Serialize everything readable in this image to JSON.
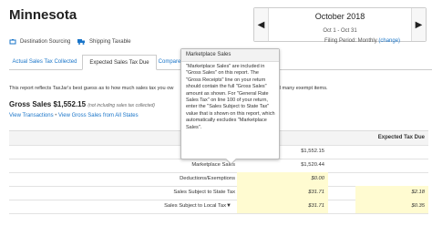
{
  "state_name": "Minnesota",
  "period": {
    "title": "October 2018",
    "range": "Oct 1 - Oct 31",
    "prev_icon": "chevron-left-icon",
    "next_icon": "chevron-right-icon"
  },
  "meta": {
    "sourcing": "Destination Sourcing",
    "taxable": "Shipping Taxable",
    "filing_label": "Filing Period: Monthly",
    "filing_change": "(change)"
  },
  "tabs": [
    {
      "label": "Actual Sales Tax Collected"
    },
    {
      "label": "Expected Sales Tax Due"
    },
    {
      "label": "Compare"
    }
  ],
  "description": "This report reflects TaxJar's best guess as to how much sales tax you ow",
  "description_tail": "ell many exempt items.",
  "gross_sales": {
    "label": "Gross Sales",
    "value": "$1,552.15",
    "note": "(not including sales tax collected)"
  },
  "links": {
    "view_transactions": "View Transactions",
    "separator": "•",
    "view_gross": "View Gross Sales from All States"
  },
  "table": {
    "expected_header": "Expected Tax Due",
    "rows": [
      {
        "label": "",
        "amount": "$1,552.15",
        "due": ""
      },
      {
        "label": "Marketplace Sales",
        "amount": "$1,520.44",
        "due": ""
      },
      {
        "label": "Deductions/Exemptions",
        "amount": "$0.00",
        "due": ""
      },
      {
        "label": "Sales Subject to State Tax",
        "amount": "$31.71",
        "due": "$2.18"
      },
      {
        "label": "Sales Subject to Local Tax",
        "amount": "$31.71",
        "due": "$0.35"
      }
    ]
  },
  "tooltip": {
    "title": "Marketplace Sales",
    "body": "\"Marketplace Sales\" are included in \"Gross Sales\" on this report. The \"Gross Receipts\" line on your return should contain the full \"Gross Sales\" amount as shown. For \"General Rate Sales Tax\" on line 100 of your return, enter the \"Sales Subject to State Tax\" value that is shown on this report, which automatically excludes \"Marketplace Sales\"."
  },
  "colors": {
    "link": "#1a75c9",
    "highlight": "#fffbd1"
  }
}
